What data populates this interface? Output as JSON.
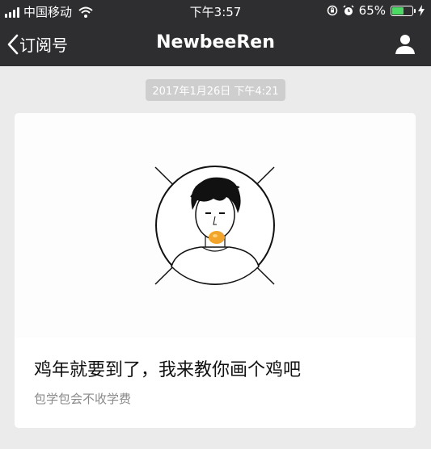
{
  "status_bar": {
    "carrier": "中国移动",
    "time": "下午3:57",
    "battery_percent": "65%",
    "battery_level": 0.65,
    "icons": [
      "signal-icon",
      "wifi-icon",
      "rotation-lock-icon",
      "alarm-icon",
      "battery-icon",
      "charging-icon"
    ],
    "battery_fill_color": "#4cd964"
  },
  "nav": {
    "back_label": "订阅号",
    "title": "NewbeeRen",
    "profile_icon": "person-icon",
    "background_color": "#2e2e30"
  },
  "message": {
    "timestamp": "2017年1月26日 下午4:21",
    "card": {
      "title": "鸡年就要到了，我来教你画个鸡吧",
      "description": "包学包会不收学费"
    }
  },
  "colors": {
    "page_background": "#ebebeb",
    "accent_orange": "#f3a42a"
  }
}
